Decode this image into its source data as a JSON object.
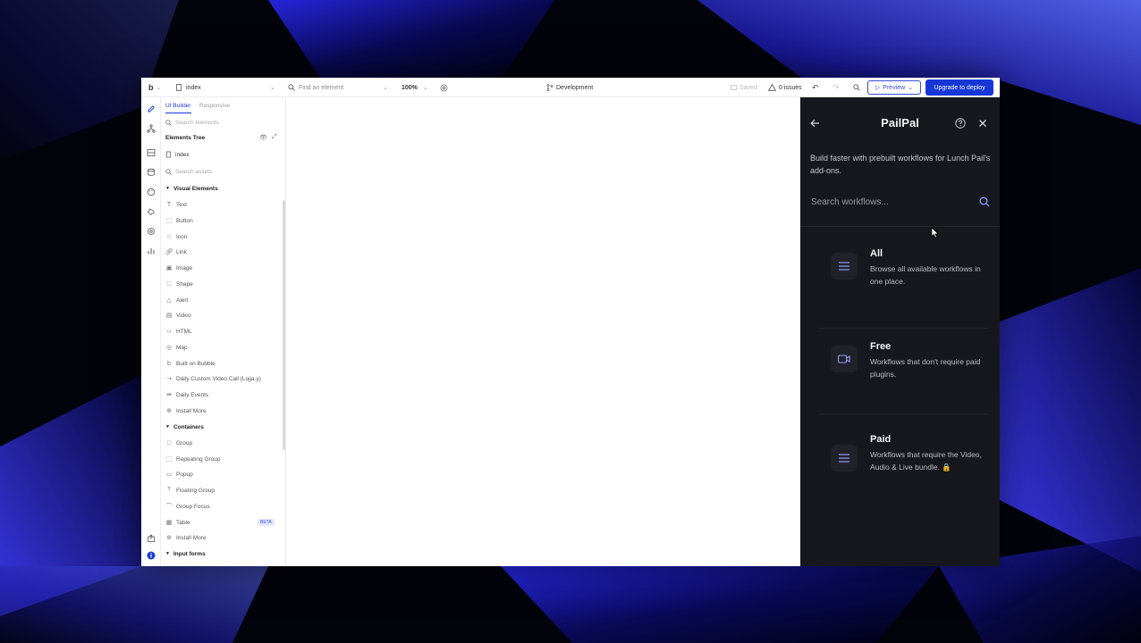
{
  "topbar": {
    "logo": "b",
    "page_selector": "index",
    "find_placeholder": "Find an element",
    "zoom": "100%",
    "branch": "Development",
    "saved": "Saved",
    "issues": "0 issues",
    "preview_label": "Preview",
    "upgrade_label": "Upgrade to deploy"
  },
  "panel": {
    "tabs": [
      "UI Builder",
      "Responsive"
    ],
    "search_elements_placeholder": "Search elements",
    "tree_title": "Elements Tree",
    "tree_root": "index",
    "search_assets_placeholder": "Search assets",
    "visual_section": "Visual Elements",
    "visual_items": [
      "Text",
      "Button",
      "Icon",
      "Link",
      "Image",
      "Shape",
      "Alert",
      "Video",
      "HTML",
      "Map",
      "Built on Bubble",
      "Daily Custom Video Call (Lojja.y)",
      "Daily Events",
      "Install More"
    ],
    "containers_section": "Containers",
    "container_items": [
      "Group",
      "Repeating Group",
      "Popup",
      "Floating Group",
      "Group Focus",
      "Table",
      "Install More"
    ],
    "table_badge": "BETA",
    "input_section": "Input forms"
  },
  "side": {
    "title": "PailPal",
    "description": "Build faster with prebuilt workflows for Lunch Pail's add-ons.",
    "search_placeholder": "Search workflows...",
    "cards": [
      {
        "title": "All",
        "desc": "Browse all available workflows in one place.",
        "icon": "list-icon"
      },
      {
        "title": "Free",
        "desc": "Workflows that don't require paid plugins.",
        "icon": "video-icon"
      },
      {
        "title": "Paid",
        "desc": "Workflows that require the Video, Audio & Live bundle. 🔒",
        "icon": "list-icon"
      }
    ]
  },
  "colors": {
    "accent": "#1736d8",
    "side_bg": "#17181d",
    "icon_tint": "#8f9cff"
  }
}
